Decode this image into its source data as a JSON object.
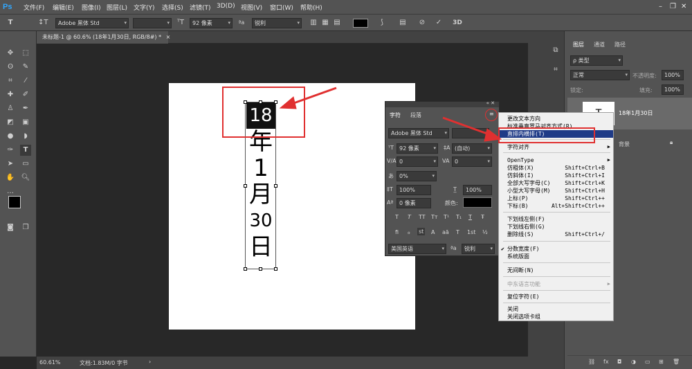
{
  "menubar": {
    "logo": "Ps",
    "items": [
      "文件(F)",
      "编辑(E)",
      "图像(I)",
      "图层(L)",
      "文字(Y)",
      "选择(S)",
      "滤镜(T)",
      "3D(D)",
      "视图(V)",
      "窗口(W)",
      "帮助(H)"
    ]
  },
  "options": {
    "font_family": "Adobe 黑体 Std",
    "font_size": "92 像素",
    "aa_label": "ªa",
    "antialias": "锐利",
    "text_color": "#000000",
    "three_d": "3D"
  },
  "document": {
    "tab_title": "未标题-1 @ 60.6% (18年1月30日, RGB/8#) *",
    "close": "×"
  },
  "canvas_text": {
    "chars": [
      "18",
      "年",
      "1",
      "月",
      "30",
      "日"
    ]
  },
  "status": {
    "zoom": "60.61%",
    "docsize": "文档:1.83M/0 字节"
  },
  "layers_panel": {
    "tabs": [
      "图层",
      "通道",
      "路径"
    ],
    "kind_placeholder": "ρ 类型",
    "blend_mode": "正常",
    "opacity_label": "不透明度:",
    "opacity": "100%",
    "lock_label": "锁定:",
    "fill_label": "填充:",
    "fill": "100%",
    "layers": [
      {
        "name": "18年1月30日",
        "type": "text"
      },
      {
        "name": "背景",
        "type": "background"
      }
    ],
    "footer_icons": [
      "link-icon",
      "fx",
      "mask-icon",
      "adjust-icon",
      "group-icon",
      "new-layer-icon",
      "trash-icon"
    ]
  },
  "char_panel": {
    "tabs": [
      "字符",
      "段落"
    ],
    "font_family": "Adobe 黑体 Std",
    "font_size": "92 像素",
    "leading": "(自动)",
    "kerning": "0",
    "tracking": "0",
    "tsume": "0%",
    "vscale": "100%",
    "hscale": "100%",
    "baseline": "0 像素",
    "color_label": "颜色:",
    "color": "#000000",
    "style_buttons": [
      "T",
      "T",
      "TT",
      "Tт",
      "T¹",
      "T₁",
      "T",
      "Ŧ"
    ],
    "ot_buttons": [
      "fi",
      "ℴ",
      "st",
      "A",
      "aā",
      "T",
      "1st",
      "½"
    ],
    "language": "美国英语",
    "aa_label": "ªa",
    "antialias": "锐利"
  },
  "context_menu": {
    "items": [
      {
        "label": "更改文本方向",
        "shortcut": ""
      },
      {
        "label": "标准垂直罗马对齐方式(R)",
        "shortcut": ""
      },
      {
        "label": "直排内横排(T)",
        "shortcut": "",
        "selected": true
      },
      {
        "label": "字符对齐",
        "shortcut": "",
        "submenu": true
      },
      {
        "label": "OpenType",
        "shortcut": "",
        "submenu": true
      },
      {
        "label": "仿粗体(X)",
        "shortcut": "Shift+Ctrl+B"
      },
      {
        "label": "仿斜体(I)",
        "shortcut": "Shift+Ctrl+I"
      },
      {
        "label": "全部大写字母(C)",
        "shortcut": "Shift+Ctrl+K"
      },
      {
        "label": "小型大写字母(M)",
        "shortcut": "Shift+Ctrl+H"
      },
      {
        "label": "上标(P)",
        "shortcut": "Shift+Ctrl++"
      },
      {
        "label": "下标(B)",
        "shortcut": "Alt+Shift+Ctrl++"
      },
      {
        "label": "下划线左侧(F)",
        "shortcut": ""
      },
      {
        "label": "下划线右侧(G)",
        "shortcut": ""
      },
      {
        "label": "删除线(S)",
        "shortcut": "Shift+Ctrl+/"
      },
      {
        "label": "分数宽度(F)",
        "shortcut": "",
        "checked": true
      },
      {
        "label": "系统版面",
        "shortcut": ""
      },
      {
        "label": "无间断(N)",
        "shortcut": ""
      },
      {
        "label": "中东语言功能",
        "shortcut": "",
        "disabled": true,
        "submenu": true
      },
      {
        "label": "复位字符(E)",
        "shortcut": ""
      },
      {
        "label": "关闭",
        "shortcut": ""
      },
      {
        "label": "关闭选项卡组",
        "shortcut": ""
      }
    ]
  },
  "colors": {
    "highlight_red": "#e03030",
    "menu_selected": "#1f3b87",
    "ps_blue": "#31a8ff"
  }
}
